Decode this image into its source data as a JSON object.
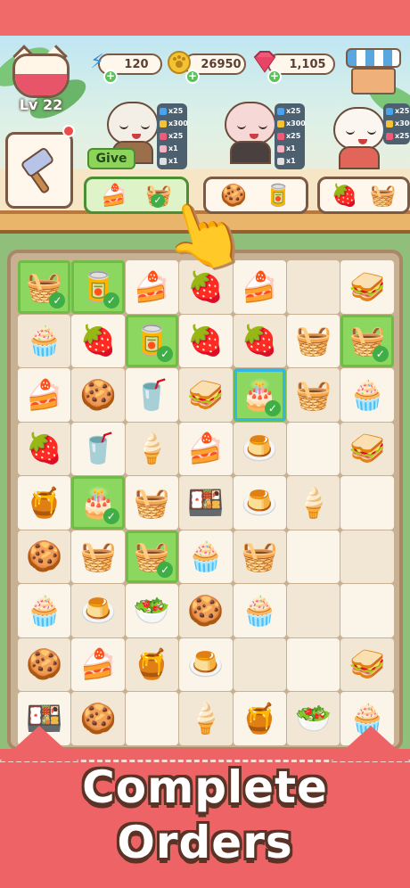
{
  "header": {
    "level_label": "Lv 22",
    "energy": "120",
    "coins": "26950",
    "gems": "1,105",
    "energy_icon": "lightning-icon",
    "coin_icon": "paw-coin-icon",
    "gem_icon": "ruby-gem-icon",
    "shop_icon": "shop-stall-icon"
  },
  "orders": {
    "give_label": "Give",
    "rewards": [
      [
        "x25",
        "x300",
        "x25",
        "x1",
        "x1"
      ],
      [
        "x25",
        "x300",
        "x25",
        "x1",
        "x1"
      ],
      [
        "x25",
        "x300",
        "x25"
      ]
    ],
    "cards": [
      {
        "items": [
          "🍰",
          "🧺"
        ],
        "ready": true
      },
      {
        "items": [
          "🍪",
          "🥫"
        ],
        "ready": false
      },
      {
        "items": [
          "🍓",
          "🧺"
        ],
        "ready": false
      }
    ]
  },
  "board": {
    "cells": [
      [
        {
          "i": "🧺",
          "s": "done"
        },
        {
          "i": "🥫",
          "s": "done"
        },
        {
          "i": "🍰",
          "s": ""
        },
        {
          "i": "🍓",
          "s": ""
        },
        {
          "i": "🍰",
          "s": ""
        },
        {
          "i": "",
          "s": ""
        },
        {
          "i": "🥪",
          "s": ""
        }
      ],
      [
        {
          "i": "🧁",
          "s": ""
        },
        {
          "i": "🍓",
          "s": ""
        },
        {
          "i": "🥫",
          "s": "done"
        },
        {
          "i": "🍓",
          "s": ""
        },
        {
          "i": "🍓",
          "s": ""
        },
        {
          "i": "🧺",
          "s": ""
        },
        {
          "i": "🧺",
          "s": "done"
        }
      ],
      [
        {
          "i": "🍰",
          "s": ""
        },
        {
          "i": "🍪",
          "s": ""
        },
        {
          "i": "🥤",
          "s": ""
        },
        {
          "i": "🥪",
          "s": ""
        },
        {
          "i": "🎂",
          "s": "done-selected"
        },
        {
          "i": "🧺",
          "s": ""
        },
        {
          "i": "🧁",
          "s": ""
        }
      ],
      [
        {
          "i": "🍓",
          "s": ""
        },
        {
          "i": "🥤",
          "s": ""
        },
        {
          "i": "🍦",
          "s": ""
        },
        {
          "i": "🍰",
          "s": ""
        },
        {
          "i": "🍮",
          "s": ""
        },
        {
          "i": "",
          "s": ""
        },
        {
          "i": "🥪",
          "s": ""
        }
      ],
      [
        {
          "i": "🍯",
          "s": ""
        },
        {
          "i": "🎂",
          "s": "done"
        },
        {
          "i": "🧺",
          "s": ""
        },
        {
          "i": "🍱",
          "s": ""
        },
        {
          "i": "🍮",
          "s": ""
        },
        {
          "i": "🍦",
          "s": ""
        },
        {
          "i": "",
          "s": ""
        }
      ],
      [
        {
          "i": "🍪",
          "s": ""
        },
        {
          "i": "🧺",
          "s": ""
        },
        {
          "i": "🧺",
          "s": "done"
        },
        {
          "i": "🧁",
          "s": ""
        },
        {
          "i": "🧺",
          "s": ""
        },
        {
          "i": "",
          "s": ""
        },
        {
          "i": "",
          "s": ""
        }
      ],
      [
        {
          "i": "🧁",
          "s": ""
        },
        {
          "i": "🍮",
          "s": ""
        },
        {
          "i": "🥗",
          "s": ""
        },
        {
          "i": "🍪",
          "s": ""
        },
        {
          "i": "🧁",
          "s": ""
        },
        {
          "i": "",
          "s": ""
        },
        {
          "i": "",
          "s": ""
        }
      ],
      [
        {
          "i": "🍪",
          "s": ""
        },
        {
          "i": "🍰",
          "s": ""
        },
        {
          "i": "🍯",
          "s": ""
        },
        {
          "i": "🍮",
          "s": ""
        },
        {
          "i": "",
          "s": ""
        },
        {
          "i": "",
          "s": ""
        },
        {
          "i": "🥪",
          "s": ""
        }
      ],
      [
        {
          "i": "🍱",
          "s": ""
        },
        {
          "i": "🍪",
          "s": ""
        },
        {
          "i": "",
          "s": ""
        },
        {
          "i": "🍦",
          "s": ""
        },
        {
          "i": "🍯",
          "s": ""
        },
        {
          "i": "🥗",
          "s": ""
        },
        {
          "i": "🧁",
          "s": ""
        }
      ]
    ]
  },
  "banner": {
    "line1": "Complete",
    "line2": "Orders"
  },
  "colors": {
    "accent": "#ee6466",
    "done": "#8cd760",
    "select": "#34b6e6"
  }
}
